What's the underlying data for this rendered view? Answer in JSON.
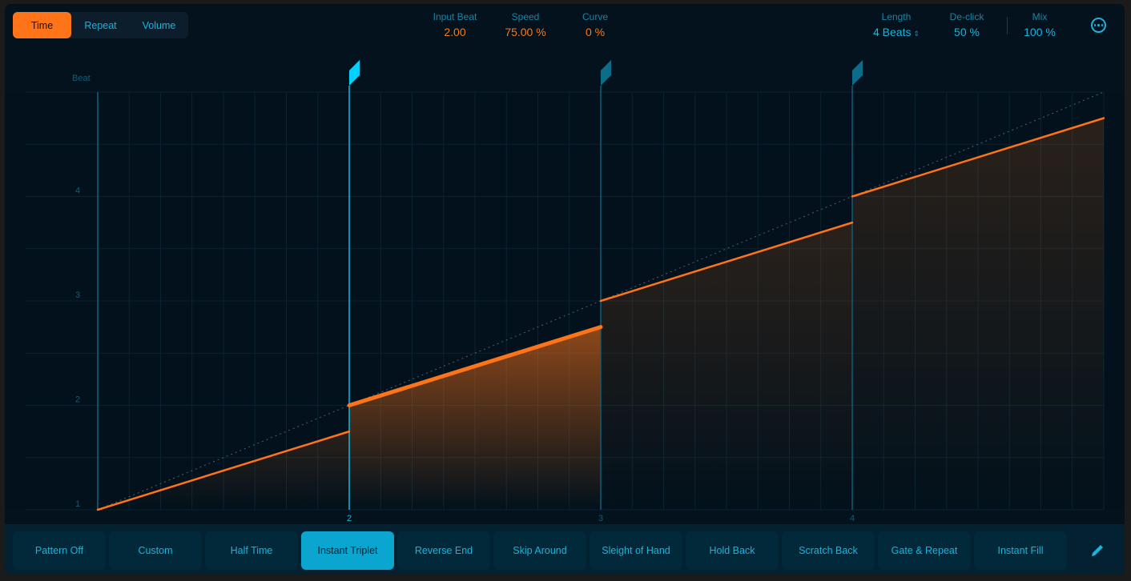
{
  "mode_tabs": [
    {
      "label": "Time",
      "active": true
    },
    {
      "label": "Repeat",
      "active": false
    },
    {
      "label": "Volume",
      "active": false
    }
  ],
  "params": {
    "input_beat": {
      "label": "Input Beat",
      "value": "2.00"
    },
    "speed": {
      "label": "Speed",
      "value": "75.00 %"
    },
    "curve": {
      "label": "Curve",
      "value": "0 %"
    },
    "length": {
      "label": "Length",
      "value": "4 Beats"
    },
    "declick": {
      "label": "De-click",
      "value": "50 %"
    },
    "mix": {
      "label": "Mix",
      "value": "100 %"
    }
  },
  "icons": {
    "more": "more-options-icon",
    "length_stepper": "up-down-chevron-icon",
    "pencil": "pencil-icon",
    "marker": "flag-marker-icon"
  },
  "colors": {
    "accent_orange": "#ff7418",
    "accent_cyan": "#17b4dc",
    "marker_selected": "#00d2ff",
    "marker_normal": "#0c6d8a",
    "background": "#03121c"
  },
  "chart_data": {
    "type": "line",
    "title": "",
    "ylabel": "Beat",
    "xlabel": "",
    "x_ticks": [
      "2",
      "3",
      "4"
    ],
    "y_ticks": [
      "1",
      "2",
      "3",
      "4"
    ],
    "xlim": [
      1,
      5
    ],
    "ylim": [
      1,
      5
    ],
    "grid": true,
    "x_subdivisions_per_beat": 8,
    "y_subdivisions_per_beat": 2,
    "reference_line": {
      "style": "dotted",
      "points": [
        [
          1,
          1
        ],
        [
          5,
          5
        ]
      ]
    },
    "segments": [
      {
        "x": [
          1,
          2
        ],
        "y": [
          1,
          1.75
        ],
        "selected": false
      },
      {
        "x": [
          2,
          3
        ],
        "y": [
          2,
          2.75
        ],
        "selected": true
      },
      {
        "x": [
          3,
          4
        ],
        "y": [
          3,
          3.75
        ],
        "selected": false
      },
      {
        "x": [
          4,
          5
        ],
        "y": [
          4,
          4.75
        ],
        "selected": false
      }
    ],
    "markers": [
      {
        "beat": 2,
        "selected": true
      },
      {
        "beat": 3,
        "selected": false
      },
      {
        "beat": 4,
        "selected": false
      }
    ]
  },
  "presets": [
    {
      "label": "Pattern Off",
      "active": false
    },
    {
      "label": "Custom",
      "active": false
    },
    {
      "label": "Half Time",
      "active": false
    },
    {
      "label": "Instant Triplet",
      "active": true
    },
    {
      "label": "Reverse End",
      "active": false
    },
    {
      "label": "Skip Around",
      "active": false
    },
    {
      "label": "Sleight of Hand",
      "active": false
    },
    {
      "label": "Hold Back",
      "active": false
    },
    {
      "label": "Scratch Back",
      "active": false
    },
    {
      "label": "Gate & Repeat",
      "active": false
    },
    {
      "label": "Instant Fill",
      "active": false
    }
  ]
}
